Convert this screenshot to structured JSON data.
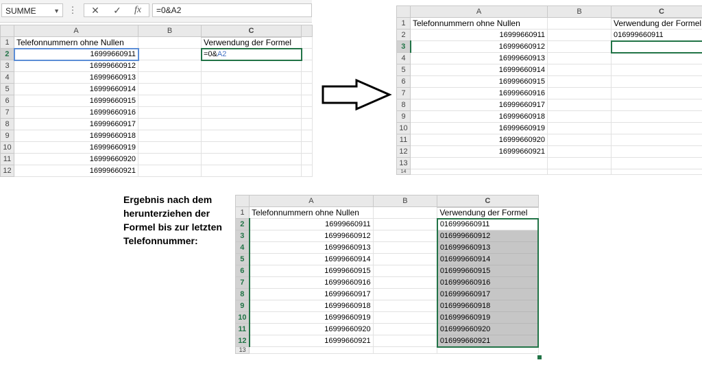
{
  "formula_bar": {
    "name_box": "SUMME",
    "dots": "⋮",
    "cancel": "✕",
    "enter": "✓",
    "fx": "fx",
    "formula": "=0&A2"
  },
  "columns": {
    "a": "A",
    "b": "B",
    "c": "C"
  },
  "header_a": "Telefonnummern ohne Nullen",
  "header_c": "Verwendung der Formel",
  "row_numbers": [
    "1",
    "2",
    "3",
    "4",
    "5",
    "6",
    "7",
    "8",
    "9",
    "10",
    "11",
    "12",
    "13",
    "14"
  ],
  "phone_numbers": [
    "16999660911",
    "16999660912",
    "16999660913",
    "16999660914",
    "16999660915",
    "16999660916",
    "16999660917",
    "16999660918",
    "16999660919",
    "16999660920",
    "16999660921"
  ],
  "formula_entry": {
    "prefix": "=0&",
    "ref": "A2"
  },
  "result_first": "016999660911",
  "results": [
    "016999660911",
    "016999660912",
    "016999660913",
    "016999660914",
    "016999660915",
    "016999660916",
    "016999660917",
    "016999660918",
    "016999660919",
    "016999660920",
    "016999660921"
  ],
  "caption": "Ergebnis nach dem herunterziehen der Formel bis zur letzten Telefonnummer:",
  "colors": {
    "excel_green": "#217346",
    "fill_gray": "#c6c6c6",
    "ref_blue": "#4472c4"
  },
  "icons": [
    "dropdown-caret-icon",
    "cancel-icon",
    "enter-icon",
    "function-icon",
    "right-arrow-icon",
    "fill-handle-icon"
  ]
}
